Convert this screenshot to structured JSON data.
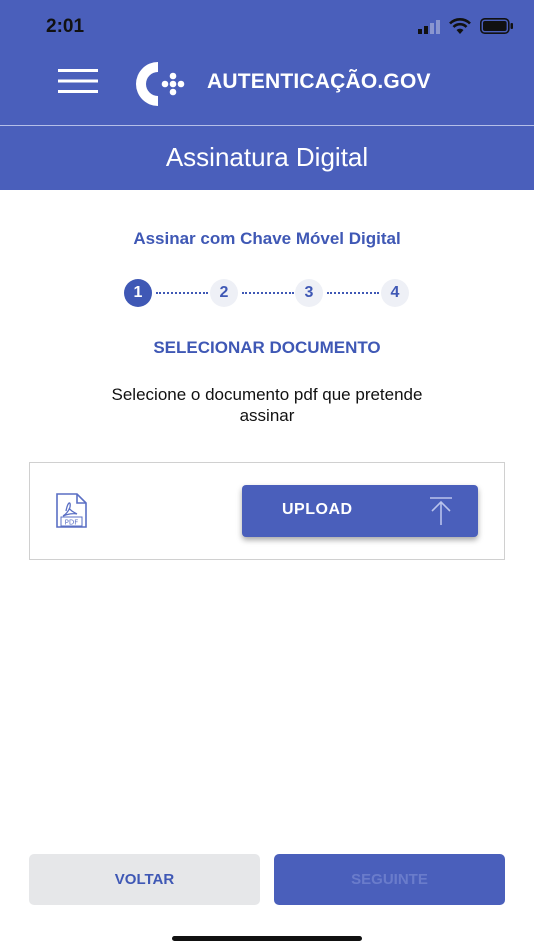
{
  "status_bar": {
    "time": "2:01"
  },
  "app_bar": {
    "brand": "AUTENTICAÇÃO.GOV",
    "menu_icon": "hamburger-icon",
    "logo_icon": "autenticacao-logo-icon"
  },
  "page": {
    "title": "Assinatura Digital",
    "subtitle": "Assinar com Chave Móvel Digital",
    "steps": [
      "1",
      "2",
      "3",
      "4"
    ],
    "current_step": 1,
    "section_title": "SELECIONAR DOCUMENTO",
    "instruction": "Selecione o documento pdf que pretende assinar"
  },
  "upload": {
    "file_icon": "pdf-file-icon",
    "file_icon_text": "PDF",
    "button_label": "UPLOAD",
    "button_icon": "upload-arrow-icon"
  },
  "footer": {
    "back_label": "VOLTAR",
    "next_label": "SEGUINTE"
  },
  "colors": {
    "primary": "#4a5fbb",
    "accent_text": "#3f58b5",
    "secondary_button": "#e6e7e9"
  }
}
